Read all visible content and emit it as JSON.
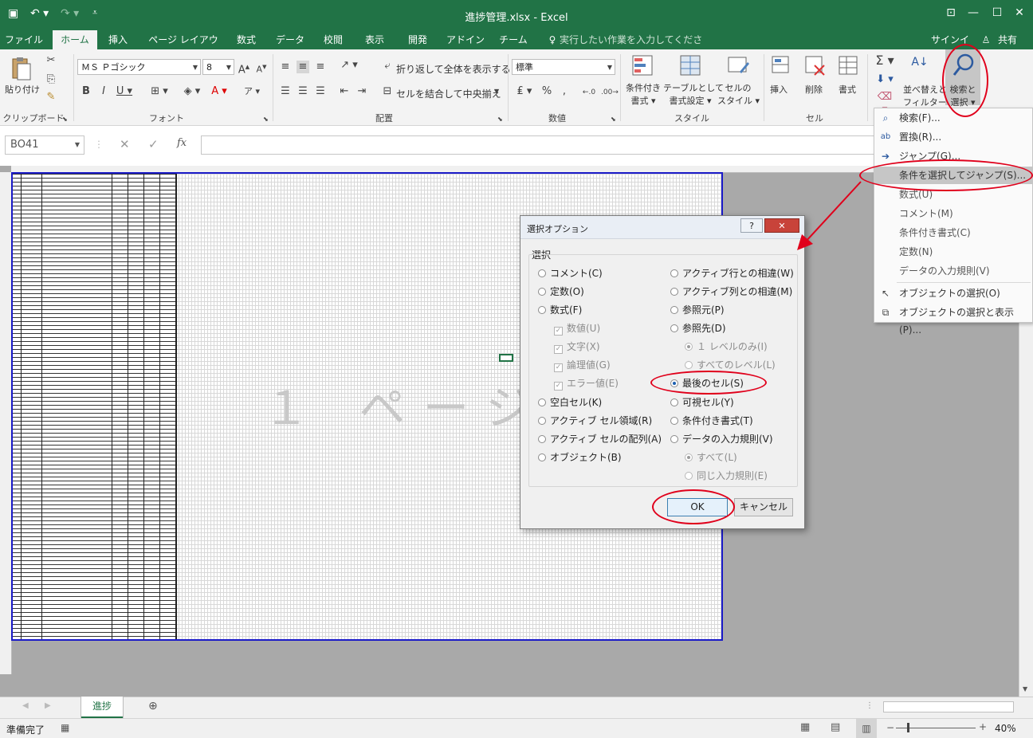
{
  "window": {
    "title": "進捗管理.xlsx - Excel"
  },
  "tabs": [
    "ファイル",
    "ホーム",
    "挿入",
    "ページ レイアウト",
    "数式",
    "データ",
    "校閲",
    "表示",
    "開発",
    "アドイン",
    "チーム"
  ],
  "tellme": "実行したい作業を入力してください...",
  "signin": "サインイン",
  "share": "共有",
  "ribbon": {
    "paste": "貼り付け",
    "font_name": "ＭＳ Ｐゴシック",
    "font_size": "8",
    "wrap_text": "折り返して全体を表示する",
    "merge_center": "セルを結合して中央揃え",
    "number_format": "標準",
    "cond_format_1": "条件付き",
    "cond_format_2": "書式",
    "table_1": "テーブルとして",
    "table_2": "書式設定",
    "cellstyle_1": "セルの",
    "cellstyle_2": "スタイル",
    "insert": "挿入",
    "delete": "削除",
    "format": "書式",
    "sort_1": "並べ替えと",
    "sort_2": "フィルター",
    "find_1": "検索と",
    "find_2": "選択",
    "groups": {
      "clipboard": "クリップボード",
      "font": "フォント",
      "align": "配置",
      "number": "数値",
      "styles": "スタイル",
      "cells": "セル"
    }
  },
  "formula_bar": {
    "name_box": "BO41",
    "fx": "fx"
  },
  "sheet": {
    "watermark": "１ ページ",
    "tab": "進捗"
  },
  "status": {
    "ready": "準備完了",
    "zoom": "40%"
  },
  "menu": {
    "items": [
      {
        "icon": "⌕",
        "label": "検索(F)..."
      },
      {
        "icon": "ab",
        "label": "置換(R)..."
      },
      {
        "icon": "➔",
        "label": "ジャンプ(G)..."
      },
      {
        "icon": "",
        "label": "条件を選択してジャンプ(S)..."
      },
      {
        "icon": "",
        "label": "数式(U)"
      },
      {
        "icon": "",
        "label": "コメント(M)"
      },
      {
        "icon": "",
        "label": "条件付き書式(C)"
      },
      {
        "icon": "",
        "label": "定数(N)"
      },
      {
        "icon": "",
        "label": "データの入力規則(V)"
      },
      {
        "icon": "↖",
        "label": "オブジェクトの選択(O)"
      },
      {
        "icon": "⧉",
        "label": "オブジェクトの選択と表示(P)..."
      }
    ]
  },
  "dialog": {
    "title": "選択オプション",
    "help": "?",
    "close": "✕",
    "group": "選択",
    "left": [
      {
        "label": "コメント(C)",
        "kind": "radio",
        "checked": false,
        "disabled": false
      },
      {
        "label": "定数(O)",
        "kind": "radio",
        "checked": false,
        "disabled": false
      },
      {
        "label": "数式(F)",
        "kind": "radio",
        "checked": false,
        "disabled": false
      },
      {
        "label": "数値(U)",
        "kind": "check",
        "checked": true,
        "disabled": true
      },
      {
        "label": "文字(X)",
        "kind": "check",
        "checked": true,
        "disabled": true
      },
      {
        "label": "論理値(G)",
        "kind": "check",
        "checked": true,
        "disabled": true
      },
      {
        "label": "エラー値(E)",
        "kind": "check",
        "checked": true,
        "disabled": true
      },
      {
        "label": "空白セル(K)",
        "kind": "radio",
        "checked": false,
        "disabled": false
      },
      {
        "label": "アクティブ セル領域(R)",
        "kind": "radio",
        "checked": false,
        "disabled": false
      },
      {
        "label": "アクティブ セルの配列(A)",
        "kind": "radio",
        "checked": false,
        "disabled": false
      },
      {
        "label": "オブジェクト(B)",
        "kind": "radio",
        "checked": false,
        "disabled": false
      }
    ],
    "right": [
      {
        "label": "アクティブ行との相違(W)",
        "kind": "radio",
        "checked": false,
        "disabled": false
      },
      {
        "label": "アクティブ列との相違(M)",
        "kind": "radio",
        "checked": false,
        "disabled": false
      },
      {
        "label": "参照元(P)",
        "kind": "radio",
        "checked": false,
        "disabled": false
      },
      {
        "label": "参照先(D)",
        "kind": "radio",
        "checked": false,
        "disabled": false
      },
      {
        "label": "１ レベルのみ(I)",
        "kind": "radio",
        "checked": true,
        "disabled": true
      },
      {
        "label": "すべてのレベル(L)",
        "kind": "radio",
        "checked": false,
        "disabled": true
      },
      {
        "label": "最後のセル(S)",
        "kind": "radio",
        "checked": true,
        "disabled": false
      },
      {
        "label": "可視セル(Y)",
        "kind": "radio",
        "checked": false,
        "disabled": false
      },
      {
        "label": "条件付き書式(T)",
        "kind": "radio",
        "checked": false,
        "disabled": false
      },
      {
        "label": "データの入力規則(V)",
        "kind": "radio",
        "checked": false,
        "disabled": false
      },
      {
        "label": "すべて(L)",
        "kind": "radio",
        "checked": true,
        "disabled": true
      },
      {
        "label": "同じ入力規則(E)",
        "kind": "radio",
        "checked": false,
        "disabled": true
      }
    ],
    "ok": "OK",
    "cancel": "キャンセル"
  },
  "colors": {
    "excel_green": "#217346",
    "annotation_red": "#e0001b",
    "page_border": "#1a1ac8"
  }
}
